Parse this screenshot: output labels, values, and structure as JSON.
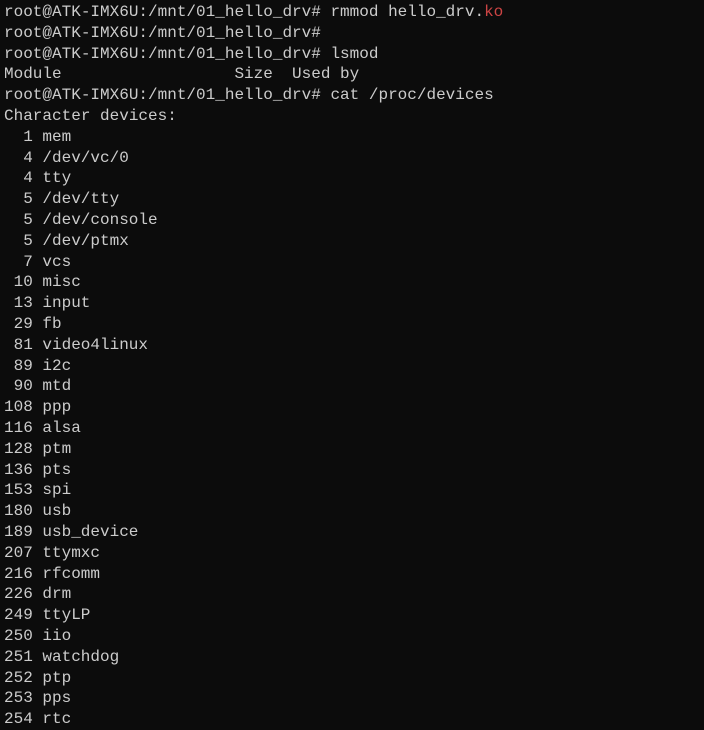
{
  "prompts": [
    {
      "prefix": "root@ATK-IMX6U:/mnt/01_hello_drv# ",
      "cmd": "rmmod hello_drv.",
      "arg_ko": "ko"
    },
    {
      "prefix": "root@ATK-IMX6U:/mnt/01_hello_drv#",
      "cmd": "",
      "arg_ko": ""
    },
    {
      "prefix": "root@ATK-IMX6U:/mnt/01_hello_drv# ",
      "cmd": "lsmod",
      "arg_ko": ""
    }
  ],
  "lsmod_header": "Module                  Size  Used by",
  "prompt_cat": {
    "prefix": "root@ATK-IMX6U:/mnt/01_hello_drv# ",
    "cmd": "cat /proc/devices"
  },
  "cat_header": "Character devices:",
  "devices": [
    {
      "num": "1",
      "name": "mem"
    },
    {
      "num": "4",
      "name": "/dev/vc/0"
    },
    {
      "num": "4",
      "name": "tty"
    },
    {
      "num": "5",
      "name": "/dev/tty"
    },
    {
      "num": "5",
      "name": "/dev/console"
    },
    {
      "num": "5",
      "name": "/dev/ptmx"
    },
    {
      "num": "7",
      "name": "vcs"
    },
    {
      "num": "10",
      "name": "misc"
    },
    {
      "num": "13",
      "name": "input"
    },
    {
      "num": "29",
      "name": "fb"
    },
    {
      "num": "81",
      "name": "video4linux"
    },
    {
      "num": "89",
      "name": "i2c"
    },
    {
      "num": "90",
      "name": "mtd"
    },
    {
      "num": "108",
      "name": "ppp"
    },
    {
      "num": "116",
      "name": "alsa"
    },
    {
      "num": "128",
      "name": "ptm"
    },
    {
      "num": "136",
      "name": "pts"
    },
    {
      "num": "153",
      "name": "spi"
    },
    {
      "num": "180",
      "name": "usb"
    },
    {
      "num": "189",
      "name": "usb_device"
    },
    {
      "num": "207",
      "name": "ttymxc"
    },
    {
      "num": "216",
      "name": "rfcomm"
    },
    {
      "num": "226",
      "name": "drm"
    },
    {
      "num": "249",
      "name": "ttyLP"
    },
    {
      "num": "250",
      "name": "iio"
    },
    {
      "num": "251",
      "name": "watchdog"
    },
    {
      "num": "252",
      "name": "ptp"
    },
    {
      "num": "253",
      "name": "pps"
    },
    {
      "num": "254",
      "name": "rtc"
    }
  ]
}
